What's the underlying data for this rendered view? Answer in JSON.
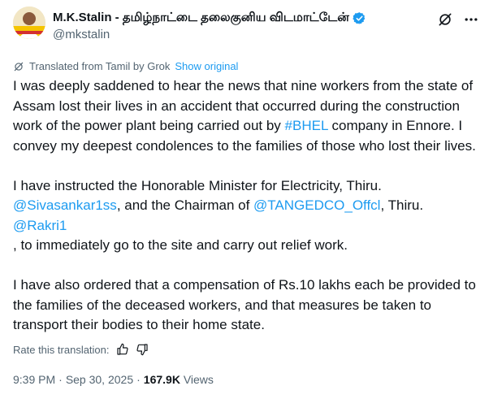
{
  "author": {
    "display_name": "M.K.Stalin - தமிழ்நாட்டை தலைகுனிய விடமாட்டேன்",
    "handle": "@mkstalin",
    "verified_color": "#1d9bf0"
  },
  "header": {
    "icons": [
      "grok-icon",
      "more-icon"
    ]
  },
  "translation": {
    "notice": "Translated from Tamil by Grok",
    "show_original": "Show original"
  },
  "tweet": {
    "p1_a": "I was deeply saddened to hear the news that nine workers from the state of Assam lost their lives in an accident that occurred during the construction work of the power plant being carried out by ",
    "p1_hashtag": "#BHEL",
    "p1_b": " company in Ennore. I convey my deepest condolences to the families of those who lost their lives.",
    "p2_a": "I have instructed the Honorable Minister for Electricity, Thiru. ",
    "p2_mention1": "@Sivasankar1ss",
    "p2_b": ", and the Chairman of ",
    "p2_mention2": "@TANGEDCO_Offcl",
    "p2_c": ", Thiru. ",
    "p2_mention3": "@Rakri1",
    "p2_d": " , to immediately go to the site and carry out relief work.",
    "p3": "I have also ordered that a compensation of Rs.10 lakhs each be provided to the families of the deceased workers, and that measures be taken to transport their bodies to their home state."
  },
  "rate": {
    "label": "Rate this translation:"
  },
  "meta": {
    "time": "9:39 PM",
    "separator": "·",
    "date": "Sep 30, 2025",
    "views_count": "167.9K",
    "views_label": "Views"
  },
  "colors": {
    "link": "#1d9bf0",
    "secondary_text": "#536471",
    "primary_text": "#0f1419"
  }
}
